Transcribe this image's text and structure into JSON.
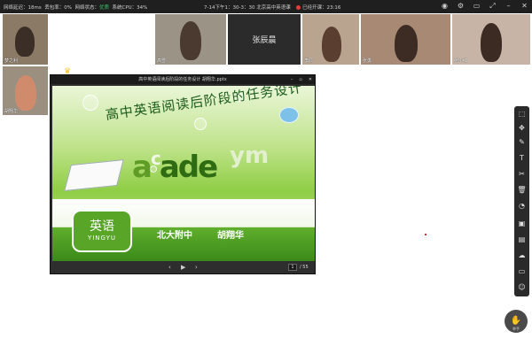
{
  "topbar": {
    "latency": "网络延迟：18ms",
    "packet_loss": "丢包率：0%",
    "quality_label": "网络状态：",
    "quality_value": "优质",
    "cpu": "系统CPU：34%",
    "session_title": "7-14下午1：30-3：30 北京高中英语课",
    "recording": "已经开课：23:16"
  },
  "participants": [
    {
      "name": "梦之利"
    },
    {
      "name": "高雪"
    },
    {
      "name": "张辰晨"
    },
    {
      "name": "李辰"
    },
    {
      "name": "张勇"
    },
    {
      "name": "张小红"
    },
    {
      "name": "胡翔华"
    }
  ],
  "presentation": {
    "window_title": "高中英语阅读后阶段的任务设计 胡翔华.pptx",
    "slide_heading": "高中英语阅读后阶段的任务设计",
    "letters_a": "a",
    "letters_c": "c",
    "letters_ade": "ade",
    "letters_ym": "ym",
    "logo_cn": "英语",
    "logo_en": "YINGYU",
    "school": "北大附中",
    "author": "胡翔华",
    "current_page": "1",
    "total_pages": "/ 55"
  },
  "raise_hand_label": "举手",
  "accent_color": "#5fae2c"
}
